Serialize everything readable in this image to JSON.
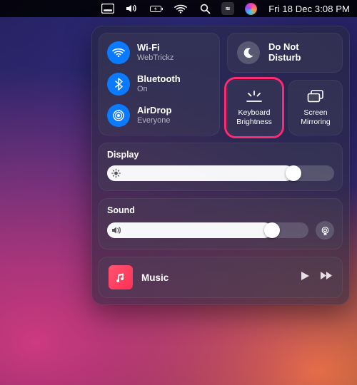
{
  "menubar": {
    "datetime": "Fri 18 Dec  3:08 PM"
  },
  "cc": {
    "connectivity": {
      "wifi": {
        "title": "Wi-Fi",
        "subtitle": "WebTrickz"
      },
      "bluetooth": {
        "title": "Bluetooth",
        "subtitle": "On"
      },
      "airdrop": {
        "title": "AirDrop",
        "subtitle": "Everyone"
      }
    },
    "dnd": {
      "label": "Do Not\nDisturb"
    },
    "keyboard_brightness": {
      "label": "Keyboard\nBrightness"
    },
    "screen_mirroring": {
      "label": "Screen\nMirroring"
    },
    "display": {
      "title": "Display",
      "value_pct": 82
    },
    "sound": {
      "title": "Sound",
      "value_pct": 82
    },
    "music": {
      "title": "Music"
    }
  },
  "colors": {
    "accent_blue": "#0a7bff",
    "highlight_pink": "#ff2a72"
  }
}
